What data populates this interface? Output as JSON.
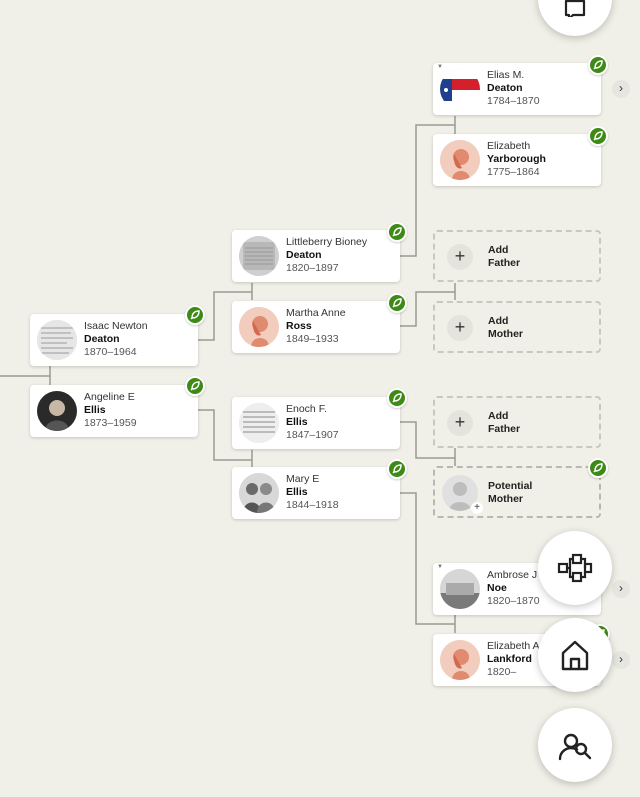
{
  "people": {
    "elias": {
      "given": "Elias M.",
      "surname": "Deaton",
      "dates": "1784–1870"
    },
    "elizabeth_y": {
      "given": "Elizabeth",
      "surname": "Yarborough",
      "dates": "1775–1864"
    },
    "littleberry": {
      "given": "Littleberry Bioney",
      "surname": "Deaton",
      "dates": "1820–1897"
    },
    "martha": {
      "given": "Martha Anne",
      "surname": "Ross",
      "dates": "1849–1933"
    },
    "isaac": {
      "given": "Isaac Newton",
      "surname": "Deaton",
      "dates": "1870–1964"
    },
    "angeline": {
      "given": "Angeline E",
      "surname": "Ellis",
      "dates": "1873–1959"
    },
    "enoch": {
      "given": "Enoch F.",
      "surname": "Ellis",
      "dates": "1847–1907"
    },
    "mary": {
      "given": "Mary E",
      "surname": "Ellis",
      "dates": "1844–1918"
    },
    "ambrose": {
      "given": "Ambrose J",
      "surname": "Noe",
      "dates": "1820–1870"
    },
    "elizabeth_l": {
      "given": "Elizabeth A",
      "surname": "Lankford",
      "dates": "1820–"
    }
  },
  "add_slots": {
    "father_1": {
      "line1": "Add",
      "line2": "Father"
    },
    "mother_1": {
      "line1": "Add",
      "line2": "Mother"
    },
    "father_2": {
      "line1": "Add",
      "line2": "Father"
    },
    "potential_mother": {
      "line1": "Potential",
      "line2": "Mother"
    }
  },
  "icons": {
    "hint": "leaf-hint-icon",
    "fab_top": "chat-icon",
    "fab_1": "tree-view-icon",
    "fab_2": "home-icon",
    "fab_3": "search-person-icon"
  },
  "colors": {
    "hint_green": "#3e8a16",
    "background": "#f0f0e8"
  },
  "glyphs": {
    "plus": "+",
    "chevron": "›",
    "tri": "▼"
  }
}
